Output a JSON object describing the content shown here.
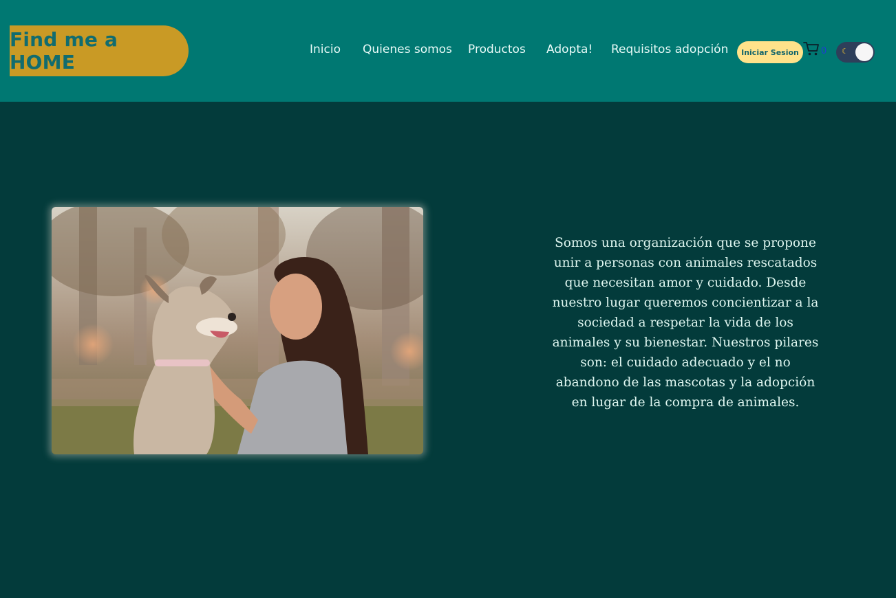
{
  "header": {
    "logo_text": "Find me a HOME",
    "nav": [
      "Inicio",
      "Quienes somos",
      "Productos",
      "Adopta!",
      "Requisitos adopción"
    ],
    "login_label": "Iniciar Sesion",
    "cart_count": "0",
    "theme_toggle_icon": "moon-icon"
  },
  "main": {
    "photo_description_icon": "woman-with-dog-photo",
    "about_text": "Somos una organización que se propone unir a personas con animales rescatados que necesitan amor y cuidado. Desde nuestro lugar queremos concientizar a la sociedad a respetar la vida de los animales y su bienestar. Nuestros pilares son: el cuidado adecuado y el no abandono de las mascotas y la adopción en lugar de la compra de animales."
  },
  "colors": {
    "header_bg": "#007872",
    "page_bg": "#033b3b",
    "logo_bg": "#c99a25",
    "login_bg": "#ffe28a",
    "text_light": "#e0f7f1"
  }
}
